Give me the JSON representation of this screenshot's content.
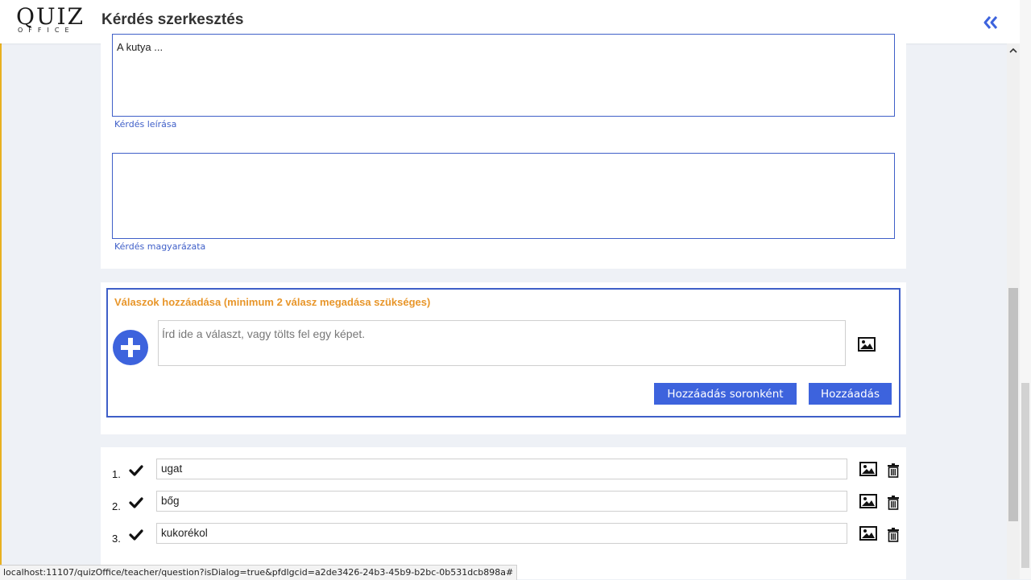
{
  "header": {
    "logo_top": "QUIZ",
    "logo_bottom": "OFFICE",
    "title": "Kérdés szerkesztés"
  },
  "question": {
    "description_value": "A kutya ...",
    "description_label": "Kérdés leírása",
    "explanation_value": "",
    "explanation_label": "Kérdés magyarázata"
  },
  "answers_add": {
    "title": "Válaszok hozzáadása (minimum 2 válasz megadása szükséges)",
    "placeholder": "Írd ide a választ, vagy tölts fel egy képet.",
    "add_by_line_label": "Hozzáadás soronként",
    "add_label": "Hozzáadás"
  },
  "answers": [
    {
      "num": "1.",
      "text": "ugat",
      "correct": true
    },
    {
      "num": "2.",
      "text": "bőg",
      "correct": true
    },
    {
      "num": "3.",
      "text": "kukorékol",
      "correct": true
    }
  ],
  "statusbar": {
    "url": "localhost:11107/quizOffice/teacher/question?isDialog=true&pfdlgcid=a2de3426-24b3-45b9-b2bc-0b531dcb898a#"
  },
  "colors": {
    "accent": "#3d63dd",
    "title_orange": "#e8962a"
  },
  "icons": [
    "double-chevron-left-icon",
    "plus-icon",
    "image-icon",
    "check-icon",
    "trash-icon",
    "scroll-up-icon"
  ]
}
